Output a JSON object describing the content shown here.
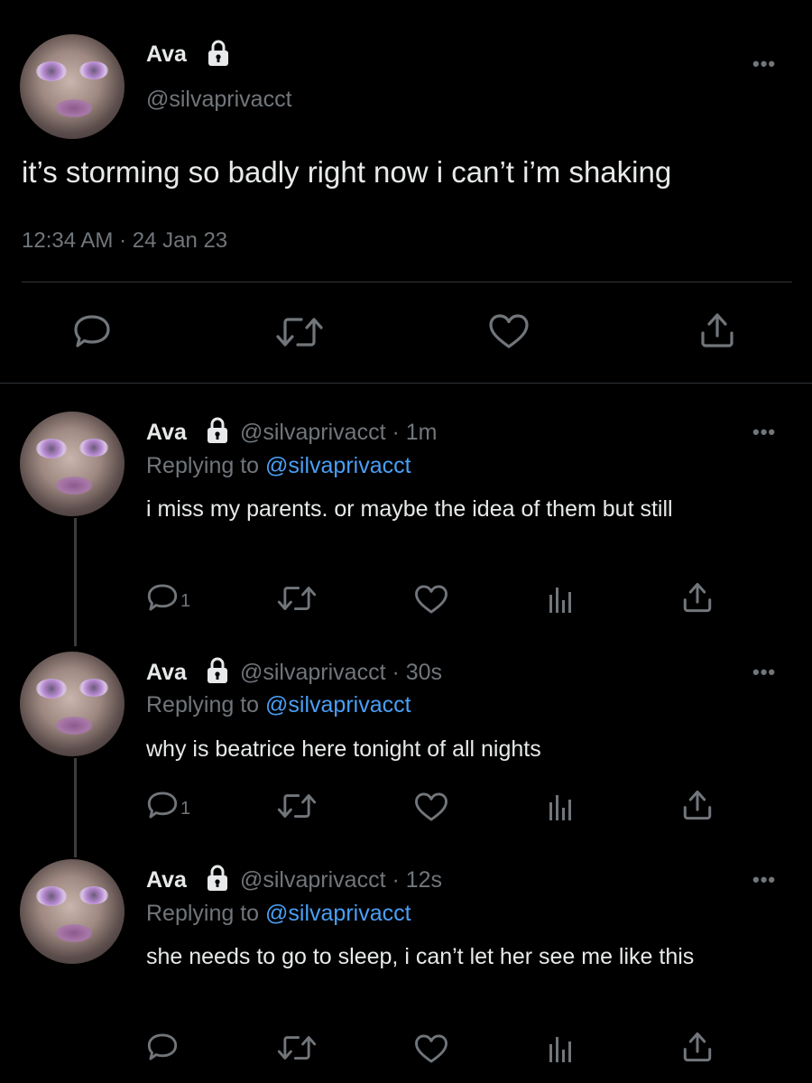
{
  "main_tweet": {
    "name": "Ava",
    "handle": "@silvaprivacct",
    "text": "it’s storming so badly right now i can’t i’m shaking",
    "timestamp": "12:34 AM · 24 Jan 23",
    "more_label": "•••"
  },
  "replies": [
    {
      "name": "Ava",
      "handle_time": "@silvaprivacct · 1m",
      "replying_prefix": "Replying to",
      "replying_to": "@silvaprivacct",
      "text": "i miss my parents. or maybe the idea of them but still",
      "reply_count": "1",
      "more_label": "•••"
    },
    {
      "name": "Ava",
      "handle_time": "@silvaprivacct · 30s",
      "replying_prefix": "Replying to",
      "replying_to": "@silvaprivacct",
      "text": "why is beatrice here tonight of all nights",
      "reply_count": "1",
      "more_label": "•••"
    },
    {
      "name": "Ava",
      "handle_time": "@silvaprivacct · 12s",
      "replying_prefix": "Replying to",
      "replying_to": "@silvaprivacct",
      "text": "she needs to go to sleep, i can’t let her see me like this",
      "reply_count": "",
      "more_label": "•••"
    }
  ],
  "colors": {
    "background": "#000000",
    "text": "#e7e9ea",
    "muted": "#71767b",
    "link": "#4a9ff5",
    "divider": "#2f3336"
  },
  "icons": [
    "lock-icon",
    "more-icon",
    "reply-icon",
    "retweet-icon",
    "like-icon",
    "share-icon",
    "analytics-icon"
  ]
}
